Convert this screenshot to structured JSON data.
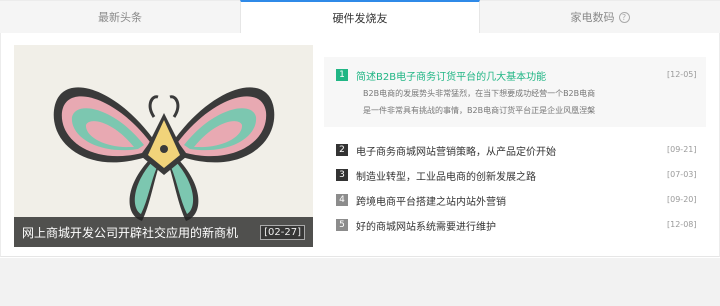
{
  "tabs": [
    {
      "label": "最新头条",
      "active": false
    },
    {
      "label": "硬件发烧友",
      "active": true
    },
    {
      "label": "家电数码",
      "active": false,
      "help_icon": "?"
    }
  ],
  "feature": {
    "caption": "网上商城开发公司开辟社交应用的新商机",
    "date": "[02-27]",
    "image_icon": "butterfly-illustration"
  },
  "news": [
    {
      "num": "1",
      "title": "简述B2B电子商务订货平台的几大基本功能",
      "date": "[12-05]",
      "summary_line1": "B2B电商的发展势头非常猛烈，在当下想要成功经营一个B2B电商",
      "summary_line2": "是一件非常具有挑战的事情，B2B电商订货平台正是企业风凰涅槃"
    },
    {
      "num": "2",
      "title": "电子商务商城网站营销策略，从产品定价开始",
      "date": "[09-21]"
    },
    {
      "num": "3",
      "title": "制造业转型，工业品电商的创新发展之路",
      "date": "[07-03]"
    },
    {
      "num": "4",
      "title": "跨境电商平台搭建之站内站外营销",
      "date": "[09-20]"
    },
    {
      "num": "5",
      "title": "好的商城网站系统需要进行维护",
      "date": "[12-08]"
    }
  ],
  "colors": {
    "accent": "#21b685",
    "tab_active": "#2f8ae8"
  }
}
